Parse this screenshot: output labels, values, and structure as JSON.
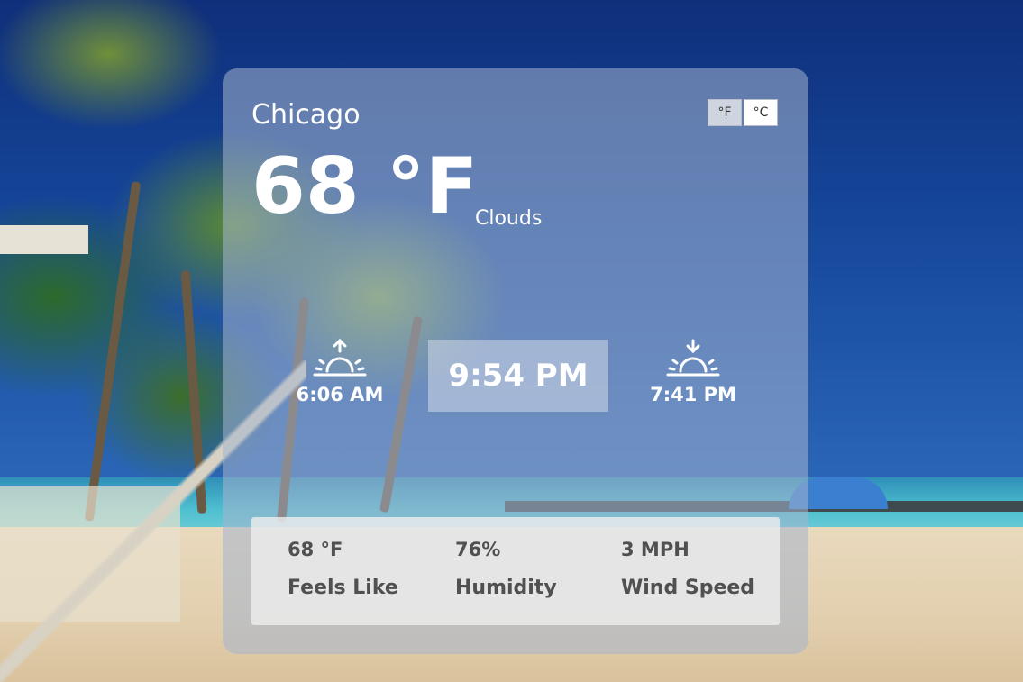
{
  "weather": {
    "city": "Chicago",
    "temperature": "68 °F",
    "condition": "Clouds",
    "units": [
      {
        "label": "°F",
        "active": true
      },
      {
        "label": "°C",
        "active": false
      }
    ],
    "sunrise": "6:06 AM",
    "sunset": "7:41 PM",
    "current_time": "9:54 PM",
    "stats": {
      "feels_like": {
        "value": "68 °F",
        "label": "Feels Like"
      },
      "humidity": {
        "value": "76%",
        "label": "Humidity"
      },
      "wind": {
        "value": "3 MPH",
        "label": "Wind Speed"
      }
    }
  },
  "icons": {
    "sunrise": "sunrise-icon",
    "sunset": "sunset-icon"
  },
  "colors": {
    "card_text": "#ffffff",
    "stat_text": "#505050"
  }
}
